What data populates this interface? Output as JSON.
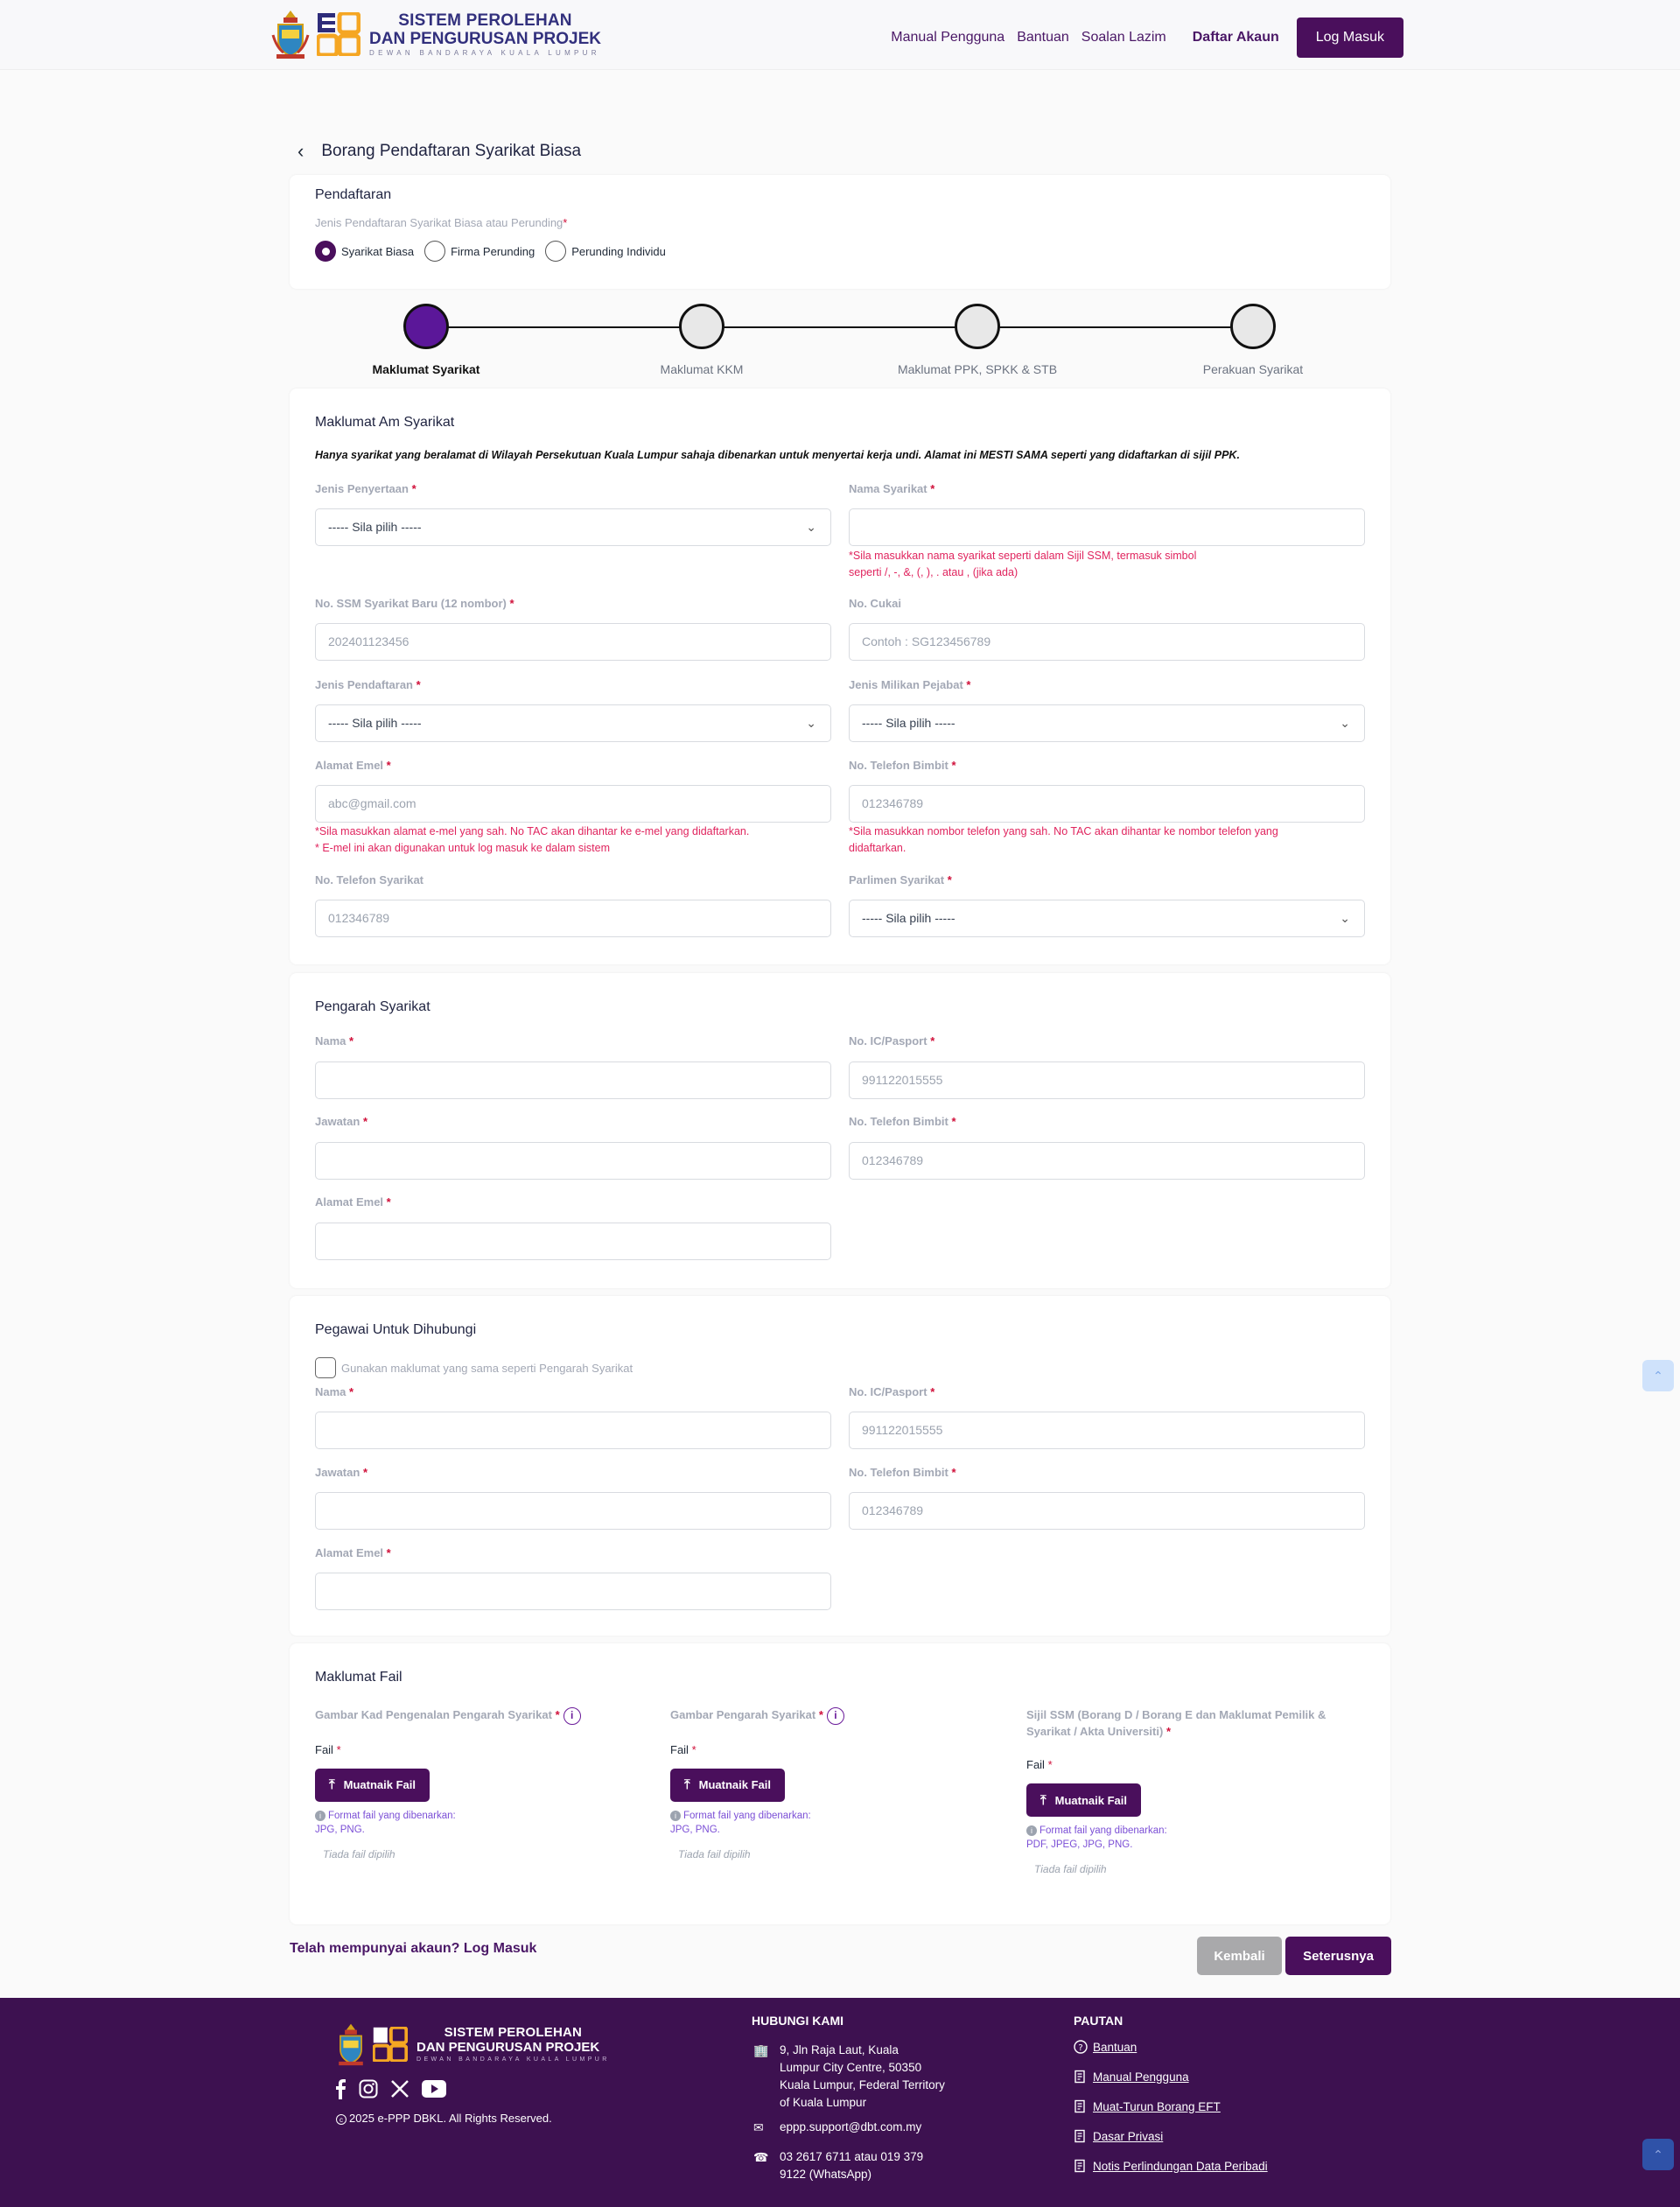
{
  "header": {
    "brand_line1": "SISTEM PEROLEHAN",
    "brand_line2": "DAN PENGURUSAN PROJEK",
    "brand_line3": "DEWAN BANDARAYA KUALA LUMPUR",
    "nav": {
      "manual": "Manual Pengguna",
      "bantuan": "Bantuan",
      "soalan": "Soalan Lazim",
      "daftar": "Daftar Akaun",
      "login": "Log Masuk"
    }
  },
  "page_title": "Borang Pendaftaran Syarikat Biasa",
  "pendaftaran": {
    "title": "Pendaftaran",
    "label": "Jenis Pendaftaran Syarikat Biasa atau Perunding",
    "options": [
      "Syarikat Biasa",
      "Firma Perunding",
      "Perunding Individu"
    ],
    "selected": "Syarikat Biasa"
  },
  "steps": [
    "Maklumat Syarikat",
    "Maklumat KKM",
    "Maklumat PPK, SPKK & STB",
    "Perakuan Syarikat"
  ],
  "maklumat_am": {
    "title": "Maklumat Am Syarikat",
    "note": "Hanya syarikat yang beralamat di Wilayah Persekutuan Kuala Lumpur sahaja dibenarkan untuk menyertai kerja undi. Alamat ini MESTI SAMA seperti yang didaftarkan di sijil PPK.",
    "jenis_penyertaan": {
      "label": "Jenis Penyertaan",
      "value": "----- Sila pilih -----"
    },
    "nama_syarikat": {
      "label": "Nama Syarikat",
      "value": "",
      "hint1": "*Sila masukkan nama syarikat seperti dalam Sijil SSM, termasuk simbol",
      "hint2": "seperti /, -, &, (, ), . atau , (jika ada)"
    },
    "no_ssm": {
      "label": "No. SSM Syarikat Baru (12 nombor)",
      "placeholder": "202401123456"
    },
    "no_cukai": {
      "label": "No. Cukai",
      "placeholder": "Contoh : SG123456789"
    },
    "jenis_pendaftaran": {
      "label": "Jenis Pendaftaran",
      "value": "----- Sila pilih -----"
    },
    "jenis_milikan": {
      "label": "Jenis Milikan Pejabat",
      "value": "----- Sila pilih -----"
    },
    "alamat_emel": {
      "label": "Alamat Emel",
      "placeholder": "abc@gmail.com",
      "hint1": "*Sila masukkan alamat e-mel yang sah. No TAC akan dihantar ke e-mel yang didaftarkan.",
      "hint2": "* E-mel ini akan digunakan untuk log masuk ke dalam sistem"
    },
    "telefon_bimbit": {
      "label": "No. Telefon Bimbit",
      "placeholder": "012346789",
      "hint1": "*Sila masukkan nombor telefon yang sah. No TAC akan dihantar ke nombor telefon yang",
      "hint2": "didaftarkan."
    },
    "telefon_syarikat": {
      "label": "No. Telefon Syarikat",
      "placeholder": "012346789"
    },
    "parlimen": {
      "label": "Parlimen Syarikat",
      "value": "----- Sila pilih -----"
    }
  },
  "pengarah": {
    "title": "Pengarah Syarikat",
    "nama": "Nama",
    "ic": "No. IC/Pasport",
    "ic_placeholder": "991122015555",
    "jawatan": "Jawatan",
    "telefon": "No. Telefon Bimbit",
    "telefon_placeholder": "012346789",
    "emel": "Alamat Emel"
  },
  "pegawai": {
    "title": "Pegawai Untuk Dihubungi",
    "checkbox": "Gunakan maklumat yang sama seperti Pengarah Syarikat",
    "nama": "Nama",
    "ic": "No. IC/Pasport",
    "ic_placeholder": "991122015555",
    "jawatan": "Jawatan",
    "telefon": "No. Telefon Bimbit",
    "telefon_placeholder": "012346789",
    "emel": "Alamat Emel"
  },
  "fail": {
    "title": "Maklumat Fail",
    "fail_label": "Fail",
    "upload": "Muatnaik Fail",
    "format_label": "Format fail yang dibenarkan:",
    "no_file": "Tiada fail dipilih",
    "items": [
      {
        "title": "Gambar Kad Pengenalan Pengarah Syarikat",
        "formats": "JPG, PNG."
      },
      {
        "title": "Gambar Pengarah Syarikat",
        "formats": "JPG, PNG."
      },
      {
        "title1": "Sijil SSM (Borang D / Borang E dan Maklumat Pemilik &",
        "title2": "Syarikat / Akta Universiti)",
        "formats": "PDF, JPEG, JPG, PNG."
      }
    ]
  },
  "bottom": {
    "login_prompt": "Telah mempunyai akaun? Log Masuk",
    "kembali": "Kembali",
    "seterusnya": "Seterusnya"
  },
  "footer": {
    "copyright": "2025 e-PPP DBKL. All Rights Reserved.",
    "hubungi_title": "HUBUNGI KAMI",
    "address": [
      "9, Jln Raja Laut, Kuala",
      "Lumpur City Centre, 50350",
      "Kuala Lumpur, Federal Territory",
      "of Kuala Lumpur"
    ],
    "email": "eppp.support@dbt.com.my",
    "phone1": "03 2617 6711 atau 019 379",
    "phone2": "9122 (WhatsApp)",
    "pautan_title": "PAUTAN",
    "links": [
      "Bantuan",
      "Manual Pengguna",
      "Muat-Turun Borang EFT",
      "Dasar Privasi",
      "Notis Perlindungan Data Peribadi"
    ]
  },
  "colors": {
    "primary": "#4a0f5c",
    "accent_step": "#5b1799",
    "error": "#e0245e",
    "footer_bg": "#3d1150"
  }
}
